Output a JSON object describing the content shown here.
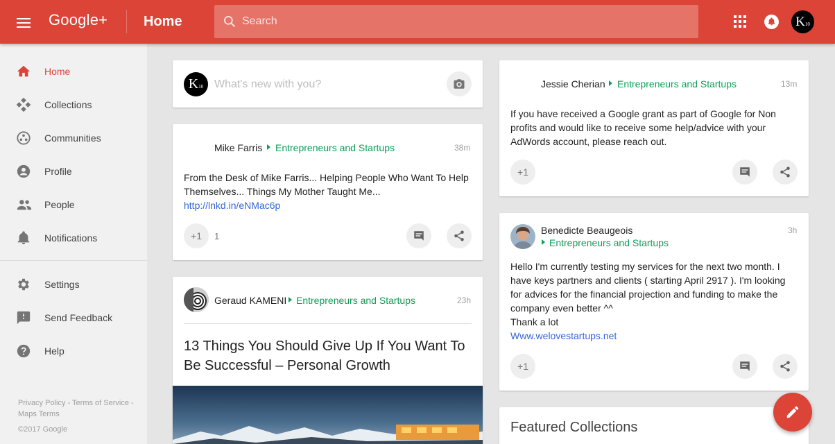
{
  "header": {
    "menu_icon": "hamburger-icon",
    "logo": "Google+",
    "title": "Home",
    "search_placeholder": "Search",
    "apps_icon": "apps-grid-icon",
    "notifications_icon": "bell-icon",
    "profile_initial": "K",
    "profile_sub": "10",
    "brand_color": "#db4437"
  },
  "sidebar": {
    "items": [
      {
        "label": "Home",
        "icon": "home-icon",
        "active": true
      },
      {
        "label": "Collections",
        "icon": "collections-icon"
      },
      {
        "label": "Communities",
        "icon": "communities-icon"
      },
      {
        "label": "Profile",
        "icon": "profile-icon"
      },
      {
        "label": "People",
        "icon": "people-icon"
      },
      {
        "label": "Notifications",
        "icon": "bell-icon"
      },
      {
        "label": "Settings",
        "icon": "gear-icon"
      },
      {
        "label": "Send Feedback",
        "icon": "feedback-icon"
      },
      {
        "label": "Help",
        "icon": "help-icon"
      }
    ],
    "footer": {
      "privacy": "Privacy Policy",
      "sep1": " - ",
      "terms": "Terms of Service",
      "sep2": " - ",
      "maps_terms": "Maps Terms",
      "copyright": "©2017 Google"
    }
  },
  "share_box": {
    "placeholder": "What's new with you?",
    "camera_icon": "camera-icon"
  },
  "posts": [
    {
      "author": "Mike Farris",
      "community": "Entrepreneurs and Startups",
      "time": "38m",
      "text_line1": "From the Desk of Mike Farris... Helping People Who Want To Help",
      "text_line2": "Themselves... Things My Mother Taught Me...",
      "link": "http://lnkd.in/eNMac6p",
      "plus_one": "+1",
      "plus_count": "1"
    },
    {
      "author": "Geraud KAMENI",
      "community": "Entrepreneurs and Startups",
      "time": "23h",
      "headline": "13 Things You Should Give Up If You Want To Be Successful – Personal Growth"
    },
    {
      "author": "Jessie Cherian",
      "community": "Entrepreneurs and Startups",
      "time": "13m",
      "text_line1": "If you have received a Google grant as part of Google for Non",
      "text_line2": "profits and would like to receive some help/advice with your",
      "text_line3": "AdWords account, please reach out.",
      "plus_one": "+1"
    },
    {
      "author": "Benedicte Beaugeois",
      "community": "Entrepreneurs and Startups",
      "time": "3h",
      "text_line1": "Hello I'm currently testing my services for the next two month. I",
      "text_line2": "have keys partners and clients ( starting April 2917 ). I'm looking",
      "text_line3": "for advices for the financial projection and funding to make the",
      "text_line4": "company even better ^^",
      "text_line5": "Thank a lot",
      "link": "Www.welovestartups.net",
      "plus_one": "+1"
    }
  ],
  "featured": {
    "title": "Featured Collections"
  },
  "fab_icon": "pencil-icon"
}
